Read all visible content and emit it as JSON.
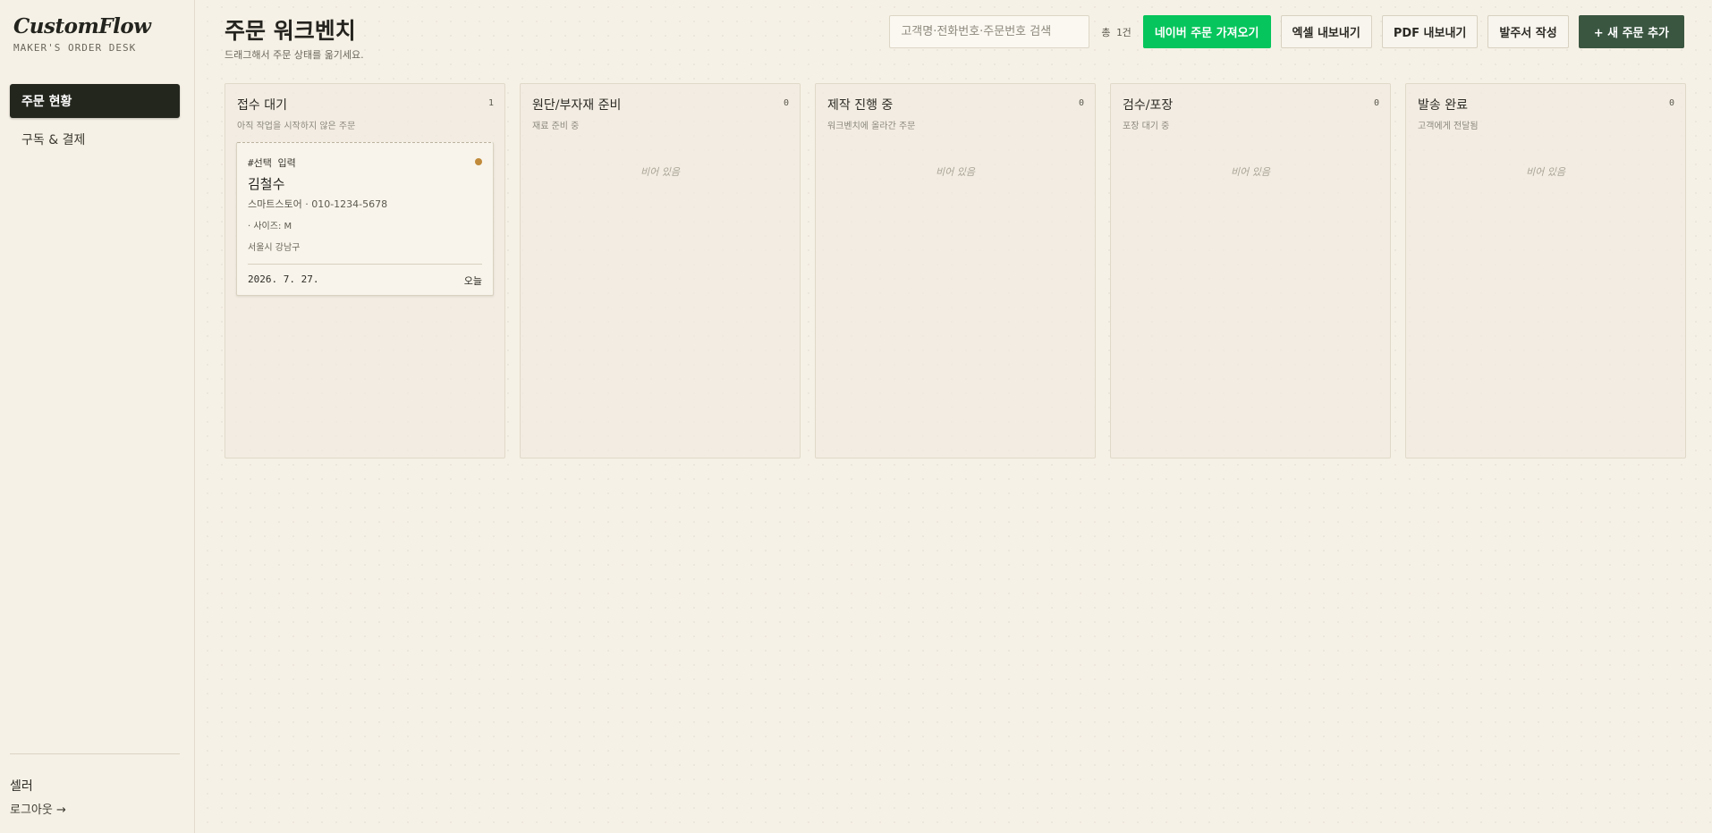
{
  "sidebar": {
    "brand": "CustomFlow",
    "brand_sub": "MAKER'S ORDER DESK",
    "items": [
      {
        "label": "주문 현황",
        "active": true
      },
      {
        "label": "구독 & 결제",
        "active": false
      }
    ],
    "role": "셀러",
    "logout": "로그아웃 →"
  },
  "header": {
    "title": "주문 워크벤치",
    "subtitle": "드래그해서 주문 상태를 옮기세요.",
    "search_placeholder": "고객명·전화번호·주문번호 검색",
    "total": "총 1건",
    "buttons": {
      "naver": "네이버 주문 가져오기",
      "excel": "엑셀 내보내기",
      "pdf": "PDF 내보내기",
      "po": "발주서 작성",
      "add": "+ 새 주문 추가"
    }
  },
  "columns": [
    {
      "title": "접수 대기",
      "count": "1",
      "desc": "아직 작업을 시작하지 않은 주문",
      "empty": ""
    },
    {
      "title": "원단/부자재 준비",
      "count": "0",
      "desc": "재료 준비 중",
      "empty": "비어 있음"
    },
    {
      "title": "제작 진행 중",
      "count": "0",
      "desc": "워크벤치에 올라간 주문",
      "empty": "비어 있음"
    },
    {
      "title": "검수/포장",
      "count": "0",
      "desc": "포장 대기 중",
      "empty": "비어 있음"
    },
    {
      "title": "발송 완료",
      "count": "0",
      "desc": "고객에게 전달됨",
      "empty": "비어 있음"
    }
  ],
  "card": {
    "tag": "#선택 입력",
    "name": "김철수",
    "meta": "스마트스토어 · 010-1234-5678",
    "size": "· 사이즈: M",
    "address": "서울시 강남구",
    "date": "2026. 7. 27.",
    "relative": "오늘",
    "dot_color": "#c08a3a"
  },
  "colors": {
    "naver": "#06c55c",
    "primary": "#3a5641",
    "sidebar_active": "#23261d"
  }
}
